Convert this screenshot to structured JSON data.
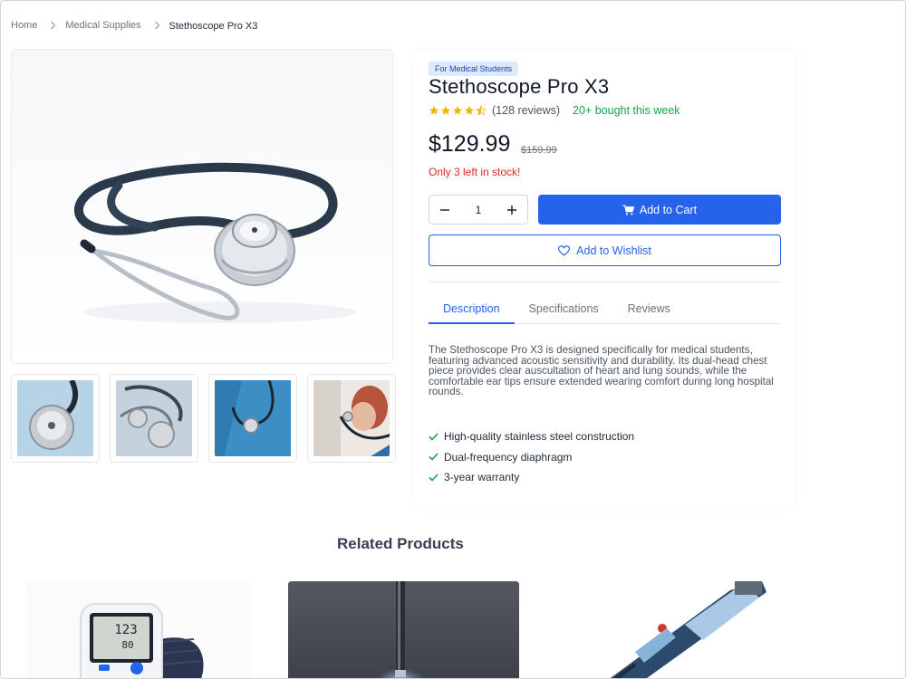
{
  "breadcrumb": {
    "home": "Home",
    "category": "Medical Supplies",
    "current": "Stethoscope Pro X3"
  },
  "product": {
    "badge": "For Medical Students",
    "title": "Stethoscope Pro X3",
    "rating": 4.5,
    "reviews": "(128 reviews)",
    "bought": "20+ bought this week",
    "price": "$129.99",
    "old_price": "$159.99",
    "stock": "Only 3 left in stock!",
    "quantity": "1",
    "add_to_cart": "Add to Cart",
    "add_to_wishlist": "Add to Wishlist"
  },
  "tabs": [
    "Description",
    "Specifications",
    "Reviews"
  ],
  "description": "The Stethoscope Pro X3 is designed specifically for medical students, featuring advanced acoustic sensitivity and durability. Its dual-head chest piece provides clear auscultation of heart and lung sounds, while the comfortable ear tips ensure extended wearing comfort during long hospital rounds.",
  "features": [
    "High-quality stainless steel construction",
    "Dual-frequency diaphragm",
    "3-year warranty"
  ],
  "related": {
    "title": "Related Products"
  },
  "colors": {
    "accent": "#2563eb",
    "success": "#16a34a",
    "danger": "#dc2626",
    "star": "#f5b301",
    "badge_bg": "#dbeafe"
  },
  "icons": {
    "breadcrumb_separator": "chevron-right-icon",
    "cart": "cart-icon",
    "wishlist": "heart-icon",
    "minus": "minus-icon",
    "plus": "plus-icon",
    "feature": "check-icon",
    "rating": "star-icon"
  }
}
